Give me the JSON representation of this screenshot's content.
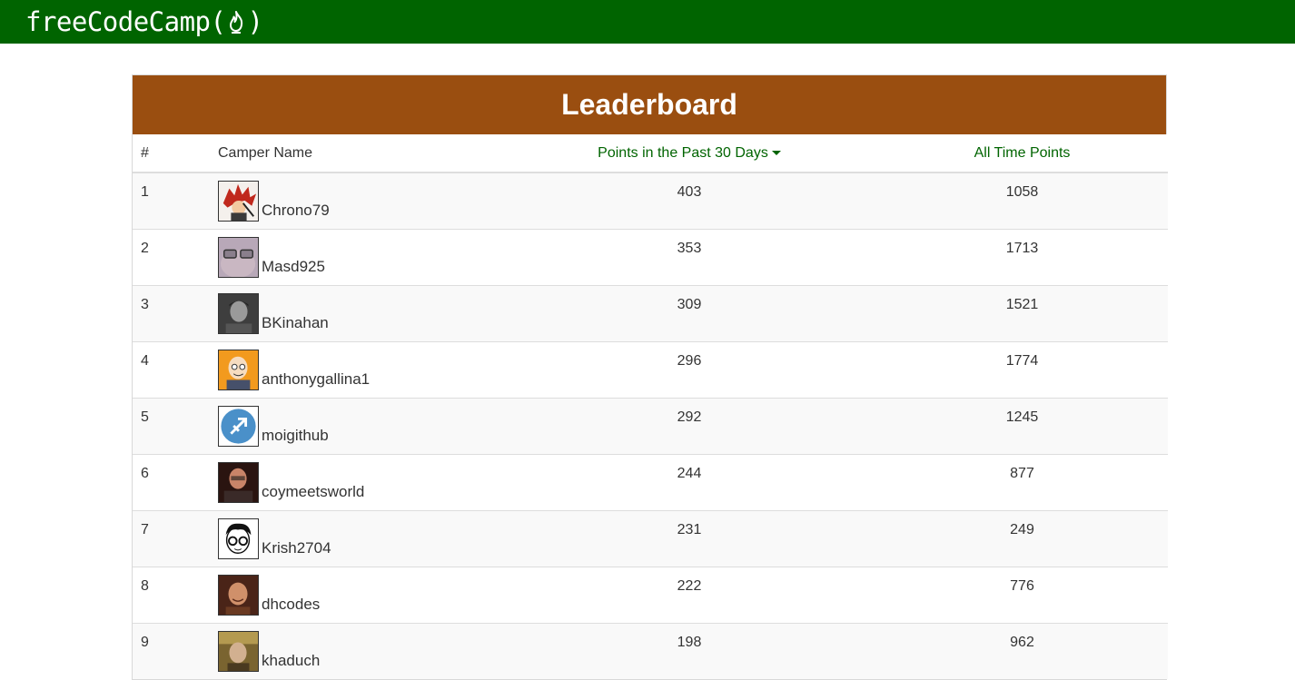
{
  "navbar": {
    "brand_prefix": "freeCodeCamp(",
    "brand_suffix": ")"
  },
  "board": {
    "title": "Leaderboard",
    "headers": {
      "rank": "#",
      "name": "Camper Name",
      "recent": "Points in the Past 30 Days",
      "alltime": "All Time Points"
    },
    "sort_indicator": "caret-down-icon",
    "rows": [
      {
        "rank": "1",
        "name": "Chrono79",
        "recent": "403",
        "alltime": "1058",
        "avatar": "avatar-red-anime-character"
      },
      {
        "rank": "2",
        "name": "Masd925",
        "recent": "353",
        "alltime": "1713",
        "avatar": "avatar-glasses-face"
      },
      {
        "rank": "3",
        "name": "BKinahan",
        "recent": "309",
        "alltime": "1521",
        "avatar": "avatar-grayscale-photo"
      },
      {
        "rank": "4",
        "name": "anthonygallina1",
        "recent": "296",
        "alltime": "1774",
        "avatar": "avatar-cartoon-man"
      },
      {
        "rank": "5",
        "name": "moigithub",
        "recent": "292",
        "alltime": "1245",
        "avatar": "avatar-sagittarius-symbol"
      },
      {
        "rank": "6",
        "name": "coymeetsworld",
        "recent": "244",
        "alltime": "877",
        "avatar": "avatar-dark-photo"
      },
      {
        "rank": "7",
        "name": "Krish2704",
        "recent": "231",
        "alltime": "249",
        "avatar": "avatar-cartoon-glasses"
      },
      {
        "rank": "8",
        "name": "dhcodes",
        "recent": "222",
        "alltime": "776",
        "avatar": "avatar-smiling-photo"
      },
      {
        "rank": "9",
        "name": "khaduch",
        "recent": "198",
        "alltime": "962",
        "avatar": "avatar-outdoor-photo"
      }
    ]
  },
  "colors": {
    "navbar_bg": "#006400",
    "title_bg": "#9a4e10",
    "sort_link": "#006400"
  }
}
